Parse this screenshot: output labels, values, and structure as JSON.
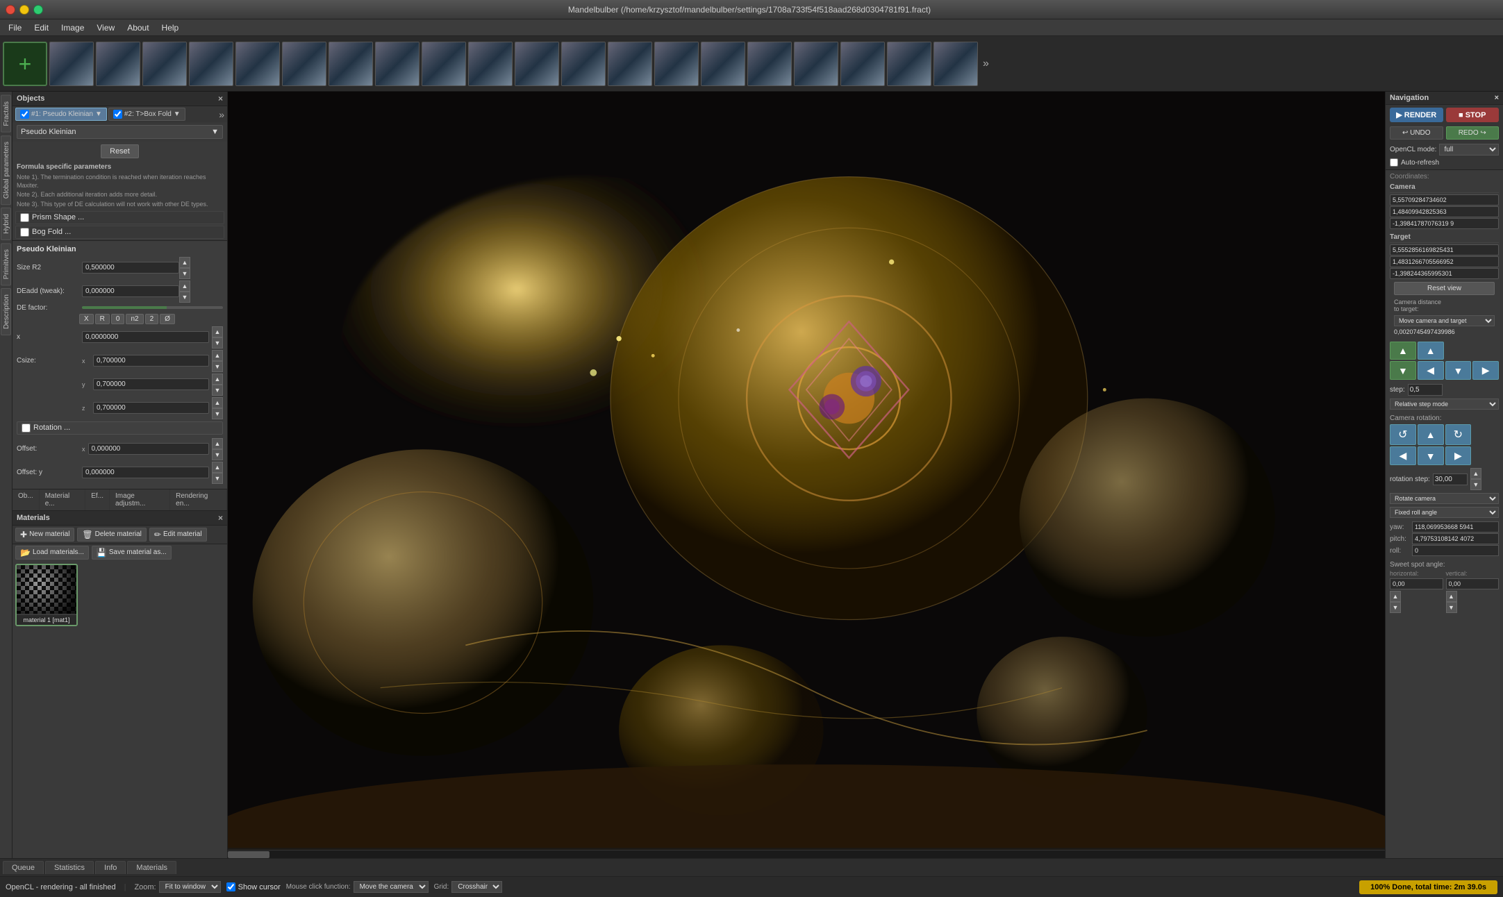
{
  "titlebar": {
    "title": "Mandelbulber (/home/krzysztof/mandelbulber/settings/1708a733f54f518aad268d0304781f91.fract)",
    "close_label": "×",
    "min_label": "−",
    "max_label": "□"
  },
  "menubar": {
    "items": [
      {
        "label": "File"
      },
      {
        "label": "Edit"
      },
      {
        "label": "Image"
      },
      {
        "label": "View"
      },
      {
        "label": "About"
      },
      {
        "label": "Help"
      }
    ]
  },
  "thumbnails": {
    "count": 20
  },
  "left_tabs": {
    "items": [
      {
        "label": "Fractals"
      },
      {
        "label": "Global parameters"
      },
      {
        "label": "Hybrid"
      },
      {
        "label": "Primitives"
      },
      {
        "label": "Description"
      }
    ]
  },
  "objects": {
    "title": "Objects",
    "tab1": {
      "label": "#1: Pseudo Kleinian",
      "active": true
    },
    "tab2": {
      "label": "#2: T>Box Fold",
      "active": false
    },
    "formula_name": "Pseudo Kleinian",
    "reset_label": "Reset",
    "formula_specific_header": "Formula specific parameters",
    "notes": [
      "Note 1). The termination condition is reached when iteration reaches Maxiter.",
      "Note 2). Each additional iteration adds more detail.",
      "Note 3). This type of DE calculation will not work with other DE types."
    ],
    "prism_label": "Prism Shape ...",
    "bog_label": "Bog Fold ...",
    "pk_header": "Pseudo Kleinian",
    "size_r2_label": "Size R2",
    "size_r2_value": "0,500000",
    "deadd_label": "DEadd (tweak):",
    "deadd_value": "0,000000",
    "de_factor_label": "DE factor:",
    "csize_label": "Csize:",
    "csize_x": "x",
    "csize_y": "y",
    "csize_z": "z",
    "csize_x_val": "0,700000",
    "csize_y_val": "0,700000",
    "csize_z_val": "0,700000",
    "xyz_buttons": [
      "X",
      "R",
      "0",
      "n2",
      "2",
      "Ø"
    ],
    "x_val": "0,0000000",
    "rotation_label": "Rotation ...",
    "offset_label": "Offset:",
    "offset_x_label": "x",
    "offset_x_val": "0,000000",
    "offset_y_label": "Offset: y",
    "offset_y_val": "0,000000"
  },
  "func_tabs": {
    "tabs": [
      {
        "label": "Ob...",
        "active": false
      },
      {
        "label": "Material e...",
        "active": false
      },
      {
        "label": "Ef...",
        "active": false
      },
      {
        "label": "Image adjustm...",
        "active": false
      },
      {
        "label": "Rendering en...",
        "active": false
      }
    ]
  },
  "materials": {
    "title": "Materials",
    "new_btn": "New material",
    "delete_btn": "Delete material",
    "edit_btn": "Edit material",
    "load_btn": "Load materials...",
    "save_btn": "Save material as...",
    "item_label": "material 1 [mat1]"
  },
  "bottom_tabs": {
    "tabs": [
      {
        "label": "Queue",
        "active": false
      },
      {
        "label": "Statistics",
        "active": false
      },
      {
        "label": "Info",
        "active": false
      },
      {
        "label": "Materials",
        "active": false
      }
    ]
  },
  "statusbar": {
    "opencl_status": "OpenCL - rendering - all finished",
    "zoom_label": "Zoom:",
    "zoom_value": "Fit to window",
    "show_cursor_label": "Show cursor",
    "mouse_label": "Mouse click function:",
    "mouse_value": "Move the camera",
    "grid_label": "Grid:",
    "grid_value": "Crosshair",
    "progress_text": "100% Done, total time: 2m 39.0s"
  },
  "navigation": {
    "title": "Navigation",
    "render_btn": "RENDER",
    "stop_btn": "STOP",
    "undo_btn": "UNDO",
    "redo_btn": "REDO",
    "opencl_label": "OpenCL mode:",
    "opencl_value": "full",
    "autorefresh_label": "Auto-refresh",
    "coordinates_label": "Coordinates:",
    "camera_title": "Camera",
    "camera_x": "5,55709284734602",
    "camera_y": "1,48409942825363",
    "camera_z": "-1,39841787076319 9",
    "target_title": "Target",
    "target_x": "5,5552856169825431",
    "target_y": "1,4831266705566952",
    "target_z": "-1,398244365995301",
    "reset_view_btn": "Reset view",
    "cam_dist_label": "Camera distance to target:",
    "cam_dist_select": "Move camera and target",
    "cam_dist_value": "0,0020745497439986",
    "step_label": "step:",
    "step_value": "0,5",
    "step_select": "Relative step mode",
    "cam_rotation_label": "Camera rotation:",
    "rot_step_label": "rotation step:",
    "rot_step_value": "30,00",
    "rotate_cam_label": "Rotate camera",
    "fixed_roll_label": "Fixed roll angle",
    "yaw_label": "yaw:",
    "yaw_value": "118,069953668 5941",
    "pitch_label": "pitch:",
    "pitch_value": "4,79753108142 4072",
    "roll_label": "roll:",
    "roll_value": "0",
    "sweet_spot_label": "Sweet spot angle:",
    "sweet_horizontal_label": "horizontal:",
    "sweet_horizontal_val": "0,00",
    "sweet_vertical_label": "vertical:",
    "sweet_vertical_val": "0,00"
  }
}
